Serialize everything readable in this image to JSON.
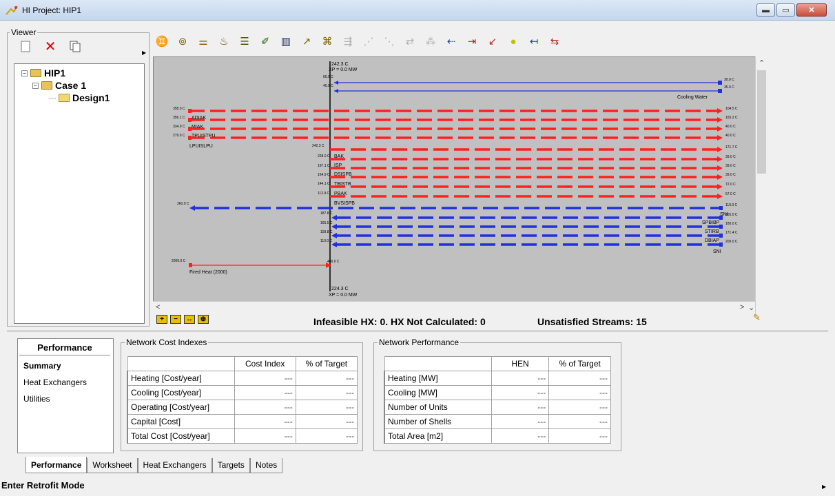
{
  "window": {
    "title": "HI Project: HIP1",
    "min": "▬",
    "max": "▭",
    "close": "✕"
  },
  "viewer": {
    "legend": "Viewer",
    "tree": [
      {
        "label": "HIP1"
      },
      {
        "label": "Case 1"
      },
      {
        "label": "Design1"
      }
    ]
  },
  "diagram": {
    "top_pinch_temp": "242.3 C",
    "top_pinch_duty": "XP = 0.0 MW",
    "bottom_pinch_temp": "224.3 C",
    "bottom_pinch_duty": "XP = 0.0 MW",
    "utility_streams": [
      {
        "name": "Cooling Water",
        "left_temp": "40.0 C",
        "right_temp": "30.0 C",
        "right_temp2": "35.0 C"
      },
      {
        "name": "Fired Heat (2000)",
        "left_temp": "2000.0 C",
        "right_temp": "400.0 C"
      }
    ],
    "stream_labels": [
      "ADIAK",
      "MIAK",
      "TPUISTPU",
      "LPUISLPU",
      "BAK",
      "ISP",
      "DSISPB",
      "TBISTB",
      "PBAK",
      "BVSISPB",
      "SNI",
      "SPBIBP",
      "STIRB",
      "DBIAP",
      "SNI"
    ],
    "hot_left_temps": [
      "358.0 C",
      "356.1 C",
      "334.9 C",
      "279.9 C"
    ],
    "hot_mid_temps": [
      "242.3 C",
      "228.0 C",
      "197.1 C",
      "164.9 C",
      "144.1 C",
      "112.9 C"
    ],
    "hot_right_temps": [
      "104.5 C",
      "165.2 C",
      "40.0 C",
      "40.0 C",
      "171.7 C",
      "39.0 C",
      "39.0 C",
      "39.0 C",
      "72.0 C",
      "57.0 C"
    ],
    "cold_left_temp": "360.0 C",
    "cold_mid_temps": [
      "187.8 C",
      "165.5 C",
      "159.8 C",
      "110.0 C"
    ],
    "cold_right_temps": [
      "110.0 C",
      "165.0 C",
      "180.0 C",
      "171.4 C",
      "200.0 C"
    ],
    "status_hx": "Infeasible HX: 0. HX Not Calculated: 0",
    "status_streams": "Unsatisfied Streams: 15"
  },
  "performance": {
    "header": "Performance",
    "items": [
      "Summary",
      "Heat Exchangers",
      "Utilities"
    ]
  },
  "cost_indexes": {
    "legend": "Network Cost Indexes",
    "columns": [
      "Cost Index",
      "% of Target"
    ],
    "rows": [
      {
        "label": "Heating [Cost/year]",
        "v1": "---",
        "v2": "---"
      },
      {
        "label": "Cooling [Cost/year]",
        "v1": "---",
        "v2": "---"
      },
      {
        "label": "Operating [Cost/year]",
        "v1": "---",
        "v2": "---"
      },
      {
        "label": "Capital [Cost]",
        "v1": "---",
        "v2": "---"
      },
      {
        "label": "Total Cost [Cost/year]",
        "v1": "---",
        "v2": "---"
      }
    ]
  },
  "network_performance": {
    "legend": "Network Performance",
    "columns": [
      "HEN",
      "% of Target"
    ],
    "rows": [
      {
        "label": "Heating [MW]",
        "v1": "---",
        "v2": "---"
      },
      {
        "label": "Cooling [MW]",
        "v1": "---",
        "v2": "---"
      },
      {
        "label": "Number of Units",
        "v1": "---",
        "v2": "---"
      },
      {
        "label": "Number of Shells",
        "v1": "---",
        "v2": "---"
      },
      {
        "label": "Total Area [m2]",
        "v1": "---",
        "v2": "---"
      }
    ]
  },
  "tabs": [
    "Performance",
    "Worksheet",
    "Heat Exchangers",
    "Targets",
    "Notes"
  ],
  "retrofit": "Enter Retrofit Mode",
  "colors": {
    "hot": "#ff2020",
    "cold": "#2030e0",
    "canvas": "#c0c0c0"
  }
}
